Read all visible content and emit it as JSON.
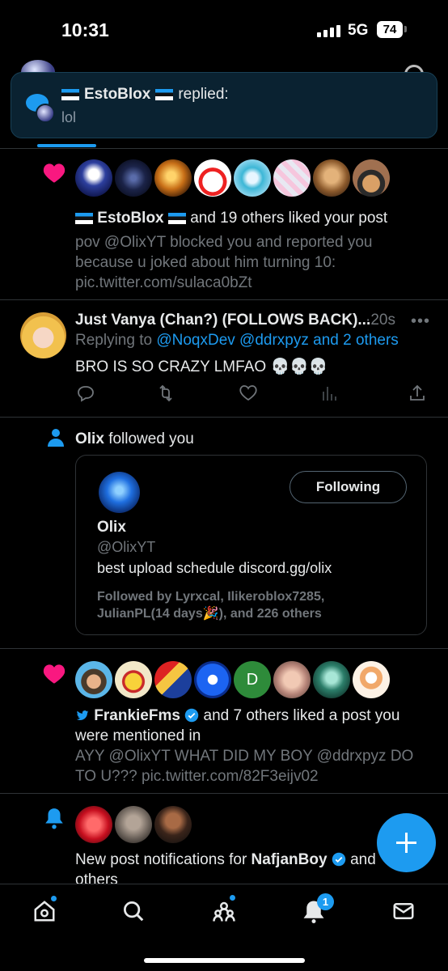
{
  "status": {
    "time": "10:31",
    "network": "5G",
    "battery": "74"
  },
  "toast": {
    "name": "EstoBlox",
    "action": "replied:",
    "message": "lol"
  },
  "notifications": [
    {
      "type": "like",
      "avatars": [
        "blue-character",
        "dark-pixel",
        "orange-glow",
        "roblox-red-cap",
        "teal-character",
        "pink-checker",
        "cat-photo",
        "witch-cat"
      ],
      "name": "EstoBlox",
      "rest": "and 19 others liked your post",
      "post_lines": [
        "pov @OlixYT blocked you and reported you",
        "because u joked about him turning 10:",
        "pic.twitter.com/sulaca0bZt"
      ]
    },
    {
      "type": "like",
      "avatars": [
        "cowboy-hat",
        "gold-crown",
        "sunglasses-team",
        "news-logo",
        "letter-d",
        "baby-photo",
        "green-armor",
        "roblox-orange"
      ],
      "avatar_letter": "D",
      "name": "FrankieFms",
      "rest": "and 7 others liked a post you",
      "rest2": "were mentioned in",
      "post_lines": [
        "AYY @OlixYT WHAT DID MY BOY @ddrxpyz DO",
        "TO U??? pic.twitter.com/82F3eijv02"
      ]
    }
  ],
  "reply_tweet": {
    "name": "Just Vanya (Chan?) (FOLLOWS BACK)...",
    "time": "·20s",
    "replying_prefix": "Replying to",
    "replying_to": "@NoqxDev @ddrxpyz and 2 others",
    "text": "BRO IS SO CRAZY LMFAO",
    "emoji": "💀💀💀"
  },
  "follow": {
    "name": "Olix",
    "action": "followed you",
    "button": "Following",
    "handle": "@OlixYT",
    "bio": "best upload schedule discord.gg/olix",
    "followed_by_1": "Followed by Lyrxcal, Ilikeroblox7285,",
    "followed_by_2": "JulianPL(14 days🎉), and 226 others"
  },
  "subscription": {
    "avatars": [
      "red-heart-face",
      "cat-photo",
      "roblox-guy"
    ],
    "prefix": "New post notifications for",
    "name": "NafjanBoy",
    "suffix": "and",
    "line2": "others"
  },
  "tabbar": {
    "items": [
      "home-icon",
      "search-icon",
      "communities-icon",
      "notifications-icon",
      "messages-icon"
    ],
    "notification_count": "1"
  },
  "colors": {
    "accent": "#1d9bf0",
    "like": "#f91880",
    "background": "#000000",
    "muted": "#71767b"
  }
}
